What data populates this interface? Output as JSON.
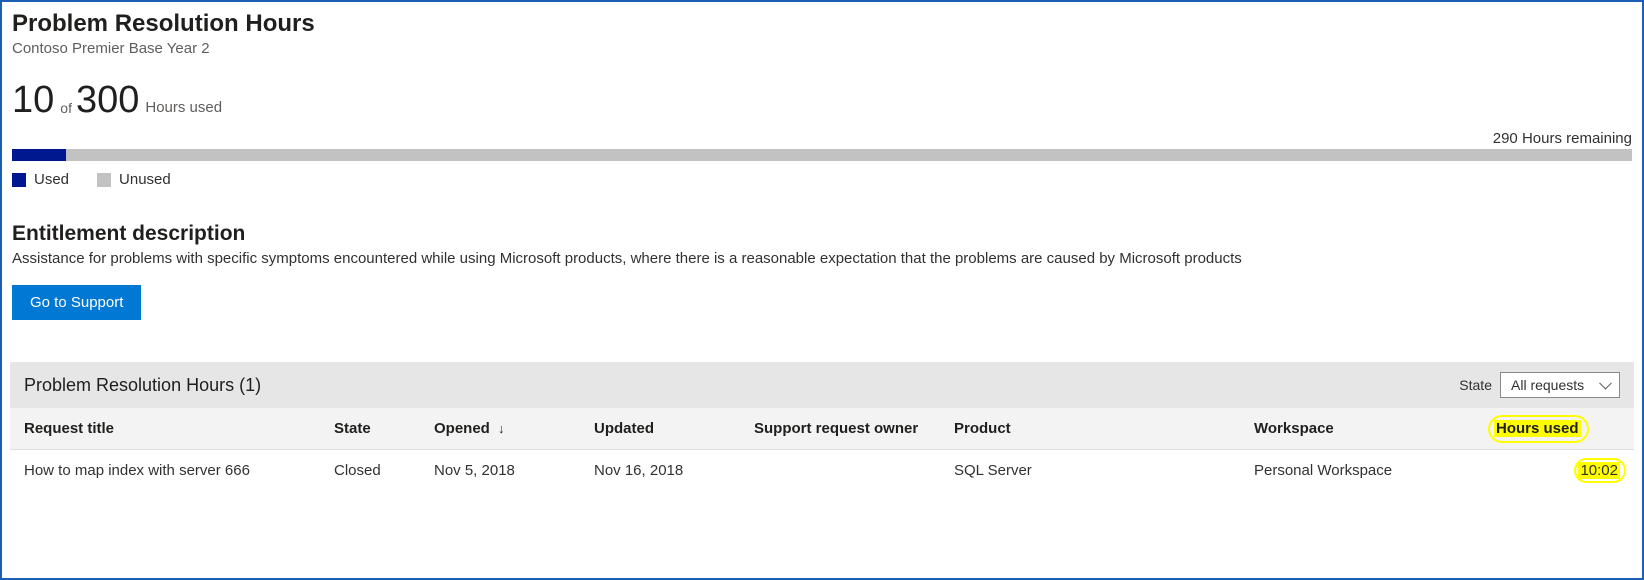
{
  "header": {
    "title": "Problem Resolution Hours",
    "subtitle": "Contoso Premier Base Year 2"
  },
  "usage": {
    "used": "10",
    "of_label": "of",
    "total": "300",
    "hours_used_label": "Hours used",
    "remaining_label": "290 Hours remaining",
    "used_percent": 3.33,
    "legend_used": "Used",
    "legend_unused": "Unused"
  },
  "entitlement": {
    "header": "Entitlement description",
    "description": "Assistance for problems with specific symptoms encountered while using Microsoft products, where there is a reasonable expectation that the problems are caused by Microsoft products",
    "support_button": "Go to Support"
  },
  "table": {
    "title": "Problem Resolution Hours (1)",
    "state_label": "State",
    "state_filter_value": "All requests",
    "columns": {
      "request_title": "Request title",
      "state": "State",
      "opened": "Opened",
      "updated": "Updated",
      "owner": "Support request owner",
      "product": "Product",
      "workspace": "Workspace",
      "hours_used": "Hours used"
    },
    "rows": [
      {
        "request_title": "How to map index with server 666",
        "state": "Closed",
        "opened": "Nov 5, 2018",
        "updated": "Nov 16, 2018",
        "owner": "",
        "product": "SQL Server",
        "workspace": "Personal Workspace",
        "hours_used": "10:02"
      }
    ]
  },
  "chart_data": {
    "type": "bar",
    "title": "Problem Resolution Hours usage",
    "categories": [
      "Used",
      "Unused"
    ],
    "values": [
      10,
      290
    ],
    "total": 300,
    "xlabel": "",
    "ylabel": "Hours",
    "ylim": [
      0,
      300
    ]
  }
}
